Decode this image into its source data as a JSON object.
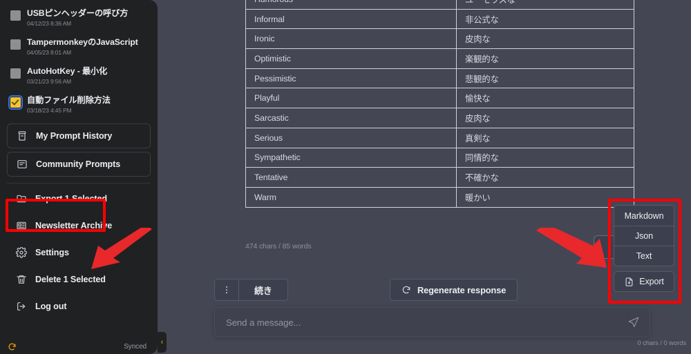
{
  "sidebar": {
    "chats": [
      {
        "title": "USBピンヘッダーの呼び方",
        "date": "04/12/23 8:36 AM",
        "checked": false
      },
      {
        "title": "TampermonkeyのJavaScript",
        "date": "04/05/23 8:01 AM",
        "checked": false
      },
      {
        "title": "AutoHotKey - 最小化",
        "date": "03/21/23 9:56 AM",
        "checked": false
      },
      {
        "title": "自動ファイル削除方法",
        "date": "03/18/23 4:45 PM",
        "checked": true
      }
    ],
    "boxed_items": [
      {
        "label": "My Prompt History",
        "icon": "archive-icon"
      },
      {
        "label": "Community Prompts",
        "icon": "book-icon"
      }
    ],
    "plain_items": [
      {
        "label": "Export 1 Selected",
        "icon": "folder-download-icon"
      },
      {
        "label": "Newsletter Archive",
        "icon": "newspaper-icon"
      },
      {
        "label": "Settings",
        "icon": "gear-icon"
      },
      {
        "label": "Delete 1 Selected",
        "icon": "trash-icon"
      },
      {
        "label": "Log out",
        "icon": "logout-icon"
      }
    ],
    "footer": {
      "sync_status": "Synced",
      "sync_icon": "refresh-icon"
    },
    "collapse_chevron": "‹"
  },
  "main": {
    "table": {
      "rows": [
        {
          "en": "Humorous",
          "ja": "ユーモラスな"
        },
        {
          "en": "Informal",
          "ja": "非公式な"
        },
        {
          "en": "Ironic",
          "ja": "皮肉な"
        },
        {
          "en": "Optimistic",
          "ja": "楽観的な"
        },
        {
          "en": "Pessimistic",
          "ja": "悲観的な"
        },
        {
          "en": "Playful",
          "ja": "愉快な"
        },
        {
          "en": "Sarcastic",
          "ja": "皮肉な"
        },
        {
          "en": "Serious",
          "ja": "真剣な"
        },
        {
          "en": "Sympathetic",
          "ja": "同情的な"
        },
        {
          "en": "Tentative",
          "ja": "不確かな"
        },
        {
          "en": "Warm",
          "ja": "暖かい"
        }
      ]
    },
    "message_char_count": "474 chars / 85 words"
  },
  "composer": {
    "kebab_icon": "more-vertical-icon",
    "continue_label": "続き",
    "regenerate_label": "Regenerate response",
    "regenerate_icon": "refresh-icon",
    "input_placeholder": "Send a message...",
    "input_value": "",
    "send_icon": "send-icon",
    "input_char_count": "0 chars / 0 words"
  },
  "export_menu": {
    "formats": [
      "Markdown",
      "Json",
      "Text"
    ],
    "export_label": "Export",
    "export_icon": "file-download-icon"
  },
  "annotations": {
    "highlight_color": "#fe0000",
    "arrow_color": "#e8282a"
  }
}
